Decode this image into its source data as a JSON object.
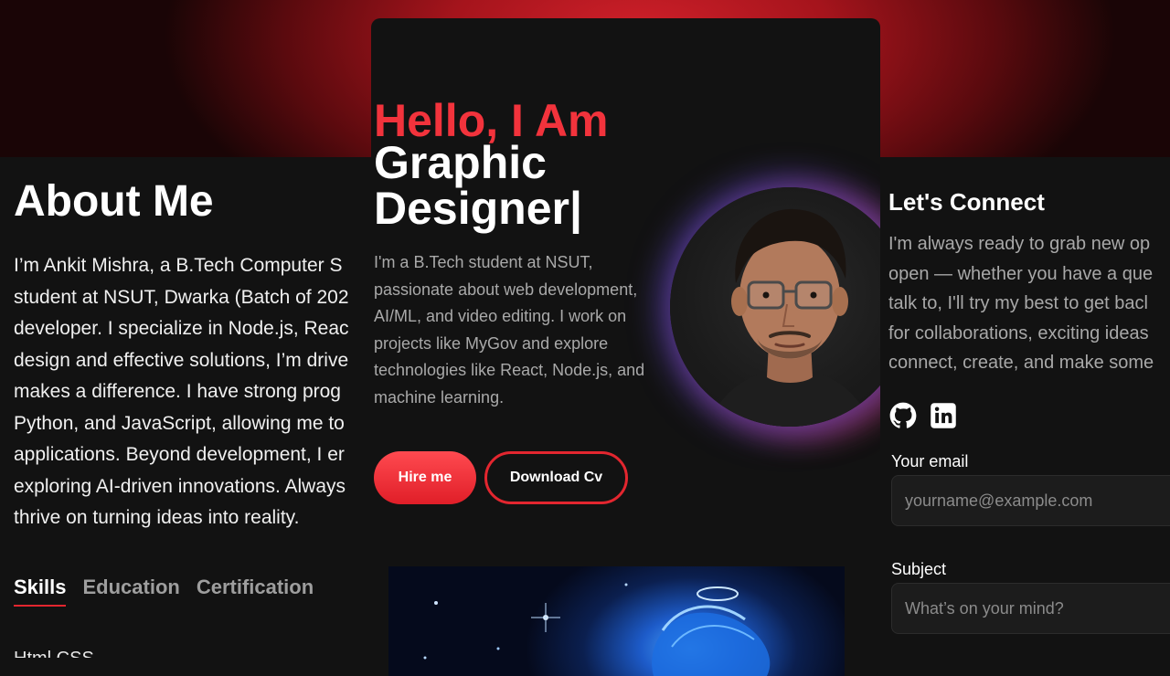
{
  "about": {
    "title": "About Me",
    "paragraph_lines": [
      "I’m Ankit Mishra, a B.Tech Computer S",
      "student at NSUT, Dwarka (Batch of 202",
      "developer. I specialize in Node.js, Reac",
      "design and effective solutions, I’m drive",
      "makes a difference. I have strong prog",
      "Python, and JavaScript, allowing me to",
      "applications. Beyond development, I er",
      "exploring AI-driven innovations. Always",
      "thrive on turning ideas into reality."
    ],
    "tabs": [
      {
        "label": "Skills",
        "active": true
      },
      {
        "label": "Education",
        "active": false
      },
      {
        "label": "Certification",
        "active": false
      }
    ],
    "skill_first": "Html CSS"
  },
  "hero": {
    "greeting": "Hello, I Am",
    "role_lines": [
      "Graphic",
      "Designer|"
    ],
    "intro_lines": [
      "I'm a B.Tech student at NSUT,",
      "passionate about web development,",
      "AI/ML, and video editing. I work on",
      "projects like MyGov and explore",
      "technologies like React, Node.js, and",
      "machine learning."
    ],
    "hire_label": "Hire me",
    "cv_label": "Download Cv"
  },
  "connect": {
    "title": "Let's Connect",
    "text_lines": [
      "I'm always ready to grab new op",
      "open — whether you have a que",
      "talk to, I'll try my best to get bacl",
      "for collaborations, exciting ideas",
      "connect, create, and make some"
    ],
    "socials": [
      "github-icon",
      "linkedin-icon"
    ],
    "email_label": "Your email",
    "email_placeholder": "yourname@example.com",
    "subject_label": "Subject",
    "subject_placeholder": "What’s on your mind?"
  },
  "colors": {
    "accent": "#e3262f",
    "greeting": "#f2333c",
    "background": "#121212",
    "muted_text": "#a8a8a8"
  }
}
